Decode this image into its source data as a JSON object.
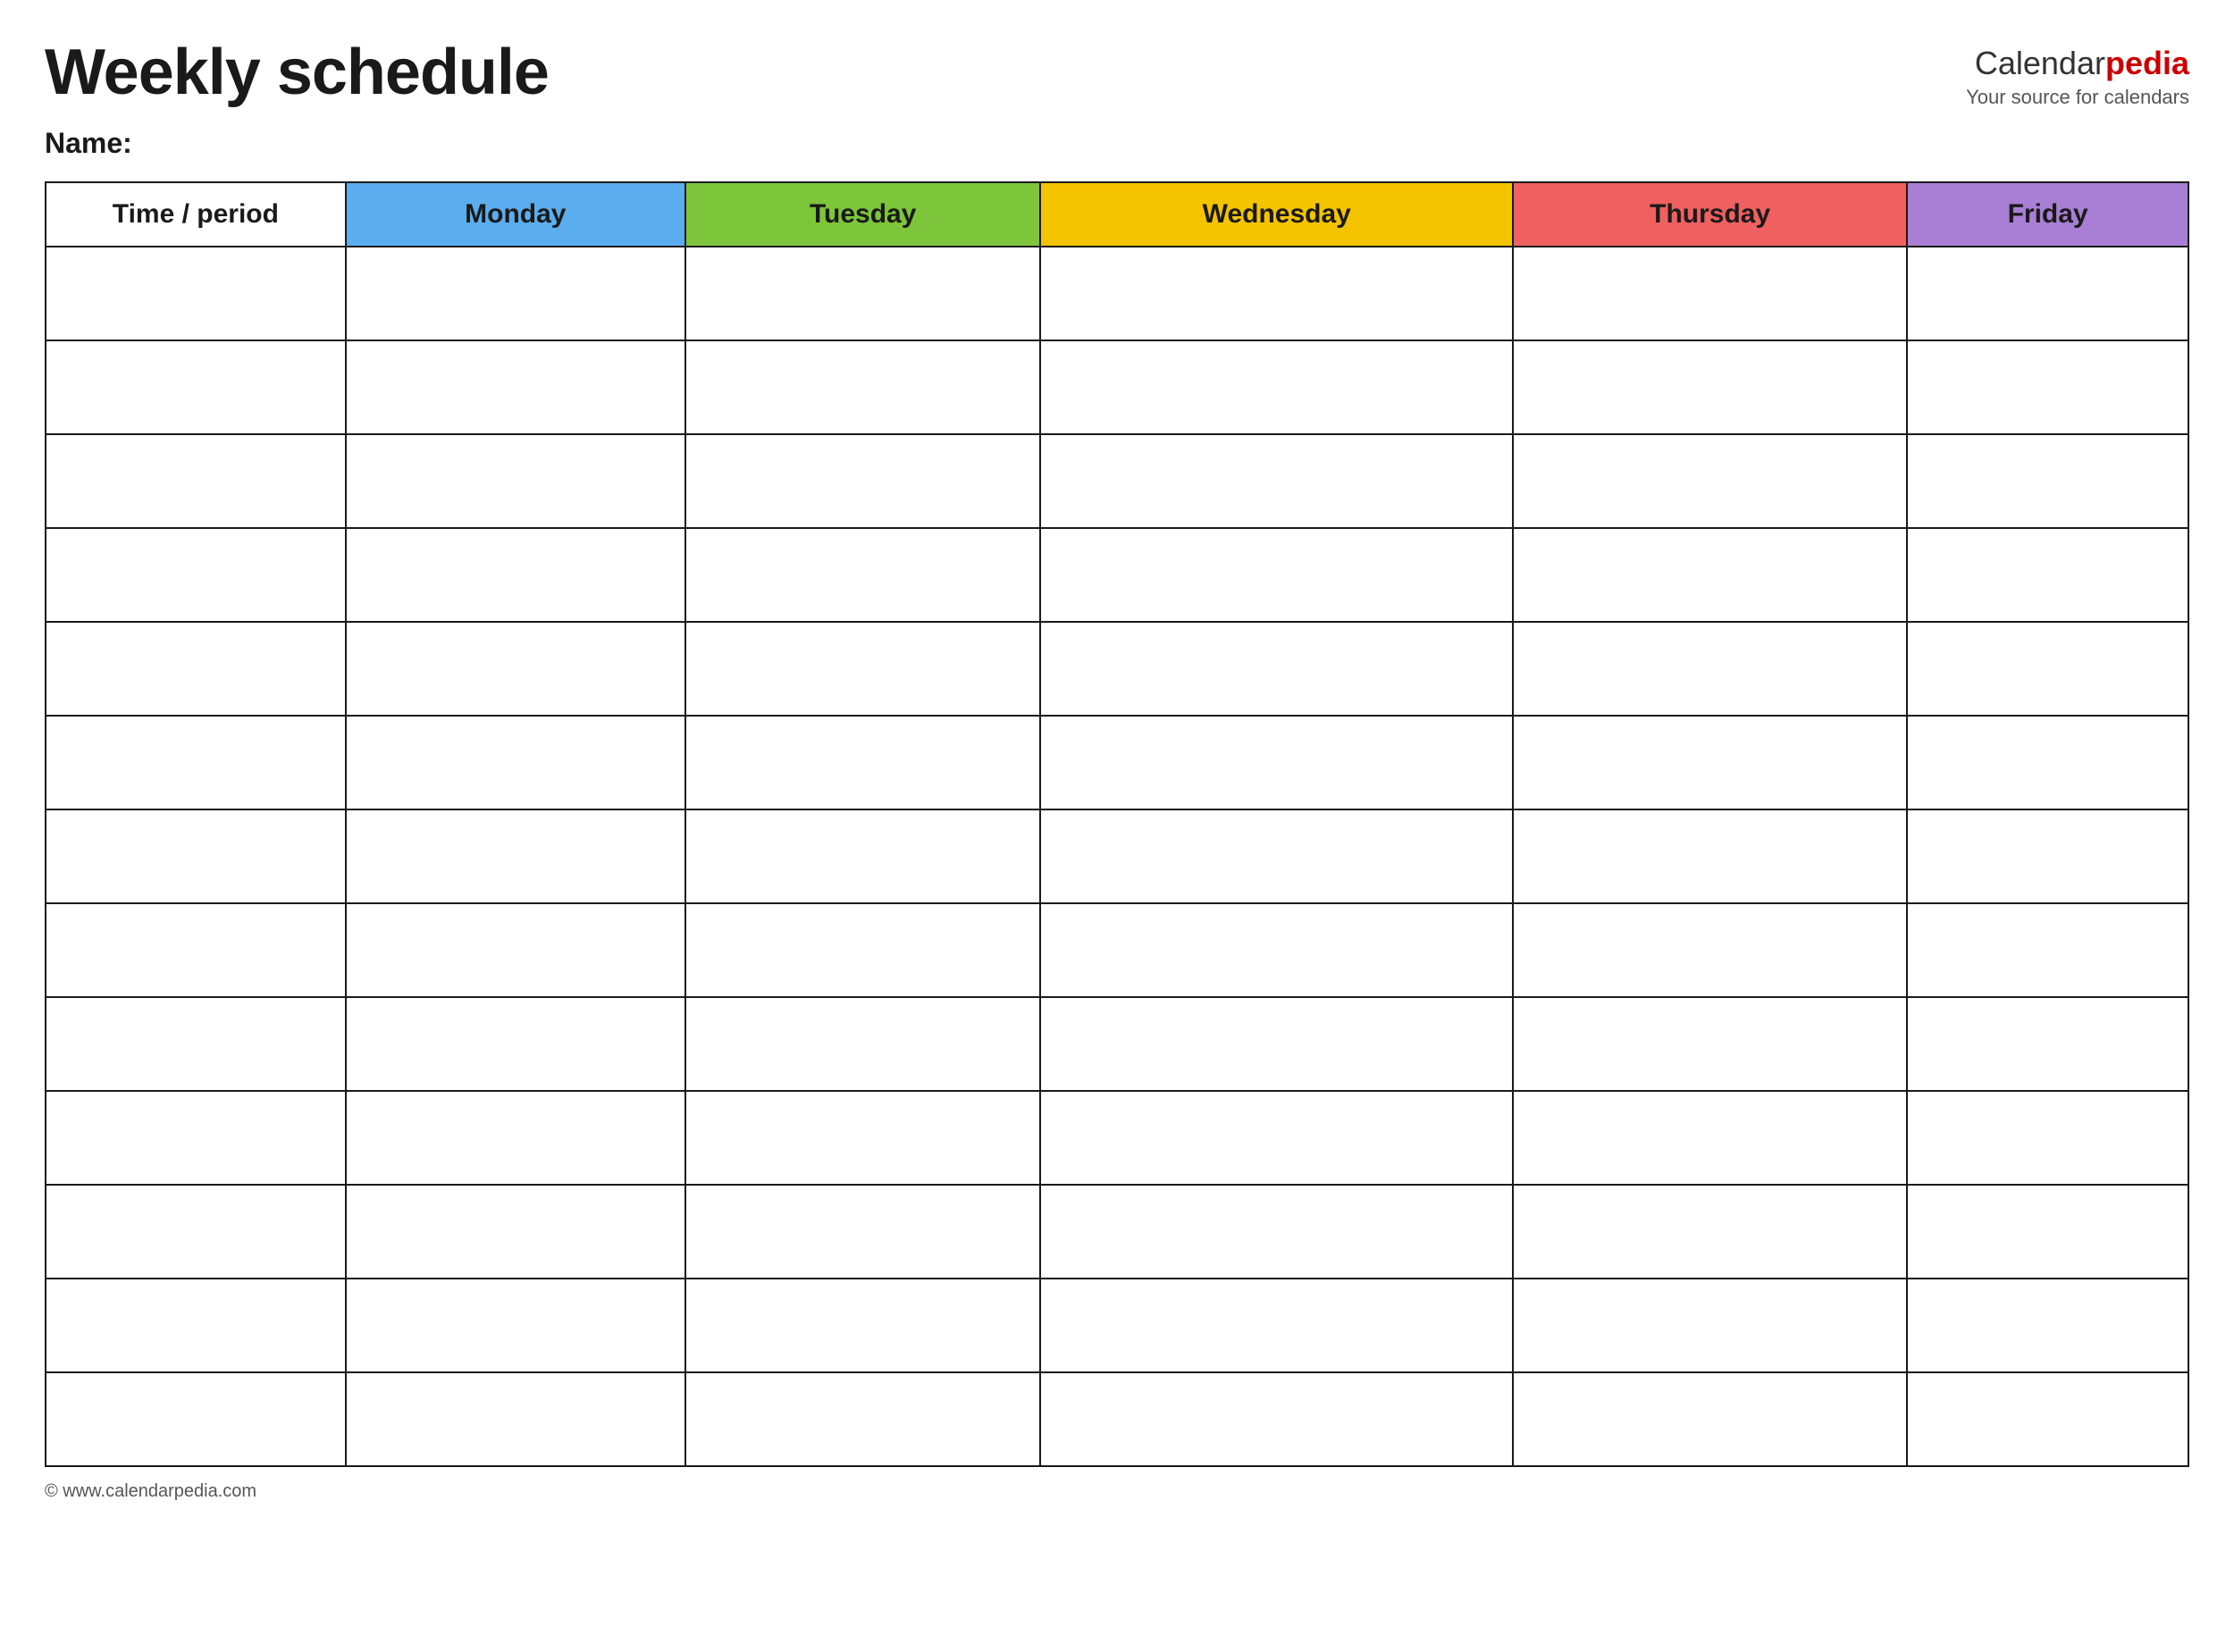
{
  "header": {
    "title": "Weekly schedule",
    "logo": {
      "calendar_part": "Calendar",
      "pedia_part": "pedia",
      "tagline": "Your source for calendars"
    }
  },
  "name_label": "Name:",
  "table": {
    "columns": [
      {
        "id": "time",
        "label": "Time / period",
        "color": "#ffffff"
      },
      {
        "id": "monday",
        "label": "Monday",
        "color": "#5badee"
      },
      {
        "id": "tuesday",
        "label": "Tuesday",
        "color": "#7dc53a"
      },
      {
        "id": "wednesday",
        "label": "Wednesday",
        "color": "#f5c400"
      },
      {
        "id": "thursday",
        "label": "Thursday",
        "color": "#f06060"
      },
      {
        "id": "friday",
        "label": "Friday",
        "color": "#a87fd4"
      }
    ],
    "row_count": 13
  },
  "footer": {
    "copyright": "© www.calendarpedia.com"
  }
}
